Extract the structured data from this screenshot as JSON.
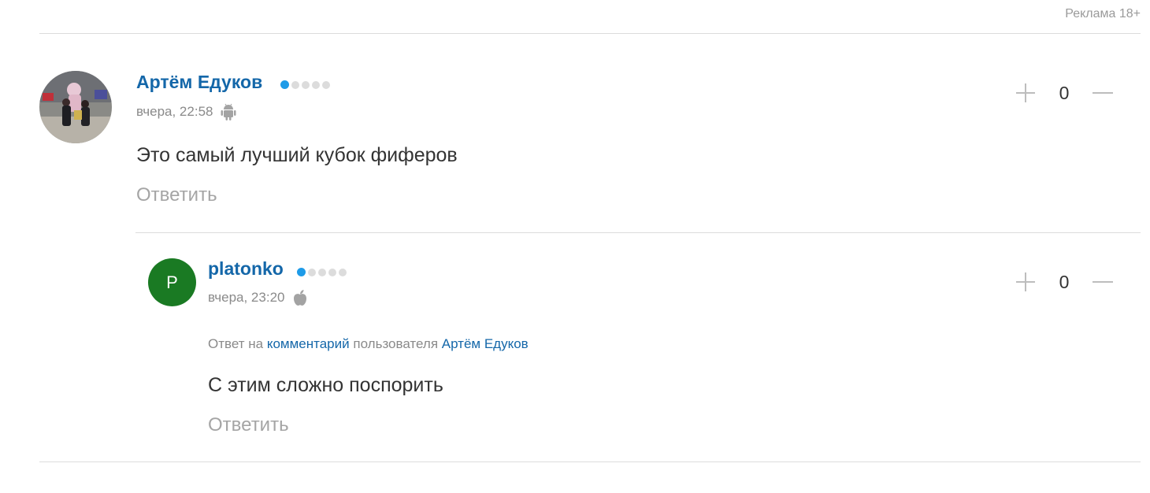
{
  "ad_label": "Реклама 18+",
  "colors": {
    "link": "#1467a9",
    "online_dot": "#1e9be8",
    "avatar_letter_bg": "#1a7a23"
  },
  "comment": {
    "author": "Артём Едуков",
    "rating_dots": 5,
    "rating_level": 1,
    "time": "вчера, 22:58",
    "device_icon": "android-icon",
    "text": "Это самый лучший кубок фиферов",
    "reply_label": "Ответить",
    "vote": {
      "plus_icon": "plus-icon",
      "score": "0",
      "minus_icon": "minus-icon"
    }
  },
  "reply": {
    "avatar_letter": "P",
    "author": "platonko",
    "rating_dots": 5,
    "rating_level": 1,
    "time": "вчера, 23:20",
    "device_icon": "apple-icon",
    "reply_to": {
      "prefix": "Ответ на",
      "comment_link": "комментарий",
      "middle": "пользователя",
      "user_link": "Артём Едуков"
    },
    "text": "С этим сложно поспорить",
    "reply_label": "Ответить",
    "vote": {
      "plus_icon": "plus-icon",
      "score": "0",
      "minus_icon": "minus-icon"
    }
  }
}
